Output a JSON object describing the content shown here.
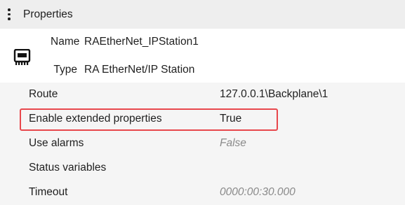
{
  "header": {
    "title": "Properties",
    "menu_icon": "more-vert-icon"
  },
  "device": {
    "icon": "device-chip-icon",
    "name_label": "Name",
    "name_value": "RAEtherNet_IPStation1",
    "type_label": "Type",
    "type_value": "RA EtherNet/IP Station"
  },
  "properties": [
    {
      "label": "Route",
      "value": "127.0.0.1\\Backplane\\1",
      "muted": false
    },
    {
      "label": "Enable extended properties",
      "value": "True",
      "muted": false
    },
    {
      "label": "Use alarms",
      "value": "False",
      "muted": true
    },
    {
      "label": "Status variables",
      "value": "",
      "muted": false
    },
    {
      "label": "Timeout",
      "value": "0000:00:30.000",
      "muted": true
    }
  ],
  "highlight_color": "#e8474c"
}
